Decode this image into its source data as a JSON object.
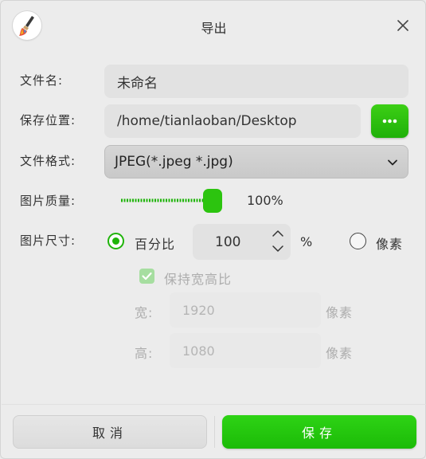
{
  "window": {
    "title": "导出",
    "app_icon": "paintbrush-icon",
    "close_icon": "close-icon"
  },
  "filename": {
    "label": "文件名:",
    "value": "未命名"
  },
  "location": {
    "label": "保存位置:",
    "value": "/home/tianlaoban/Desktop",
    "browse_icon": "more-dots-icon"
  },
  "format": {
    "label": "文件格式:",
    "selected": "JPEG(*.jpeg *.jpg)",
    "dropdown_icon": "chevron-down-icon"
  },
  "quality": {
    "label": "图片质量:",
    "value_text": "100%",
    "value": 1.0
  },
  "size": {
    "label": "图片尺寸:",
    "percent_option": "百分比",
    "percent_value": "100",
    "percent_unit": "%",
    "pixel_option": "像素",
    "selected_option": "百分比",
    "keep_ratio_label": "保持宽高比",
    "keep_ratio_checked": true,
    "width_label": "宽:",
    "width_value": "1920",
    "width_unit": "像素",
    "height_label": "高:",
    "height_value": "1080",
    "height_unit": "像素"
  },
  "buttons": {
    "cancel": "取消",
    "save": "保存"
  },
  "colors": {
    "accent": "#22bb0a",
    "field_bg": "#e2e2e2"
  }
}
